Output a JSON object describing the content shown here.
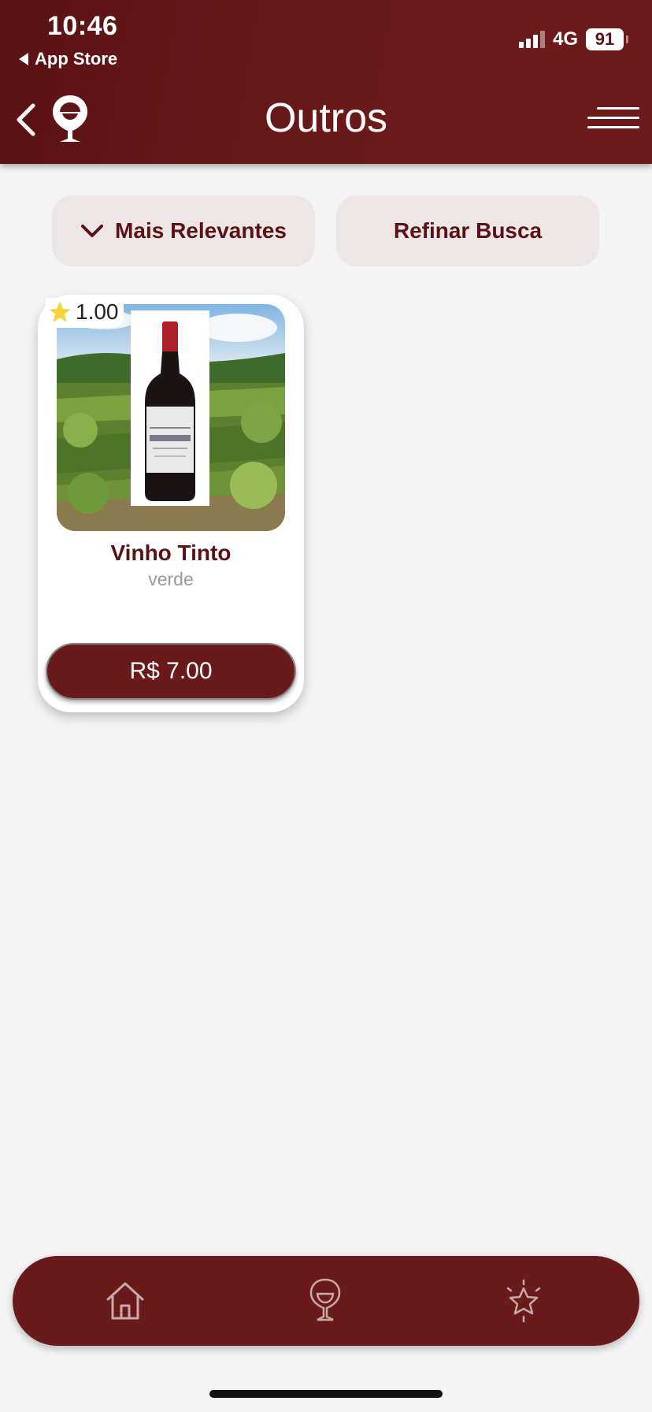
{
  "status_bar": {
    "time": "10:46",
    "back_app": "App Store",
    "network": "4G",
    "battery": "91"
  },
  "header": {
    "title": "Outros",
    "back_icon": "chevron-left-icon",
    "logo_icon": "wine-glass-pin-icon",
    "menu_icon": "hamburger-menu-icon"
  },
  "filters": {
    "sort_label": "Mais Relevantes",
    "refine_label": "Refinar Busca"
  },
  "products": [
    {
      "rating": "1.00",
      "name": "Vinho Tinto",
      "subtitle": "verde",
      "price": "R$ 7.00"
    }
  ],
  "bottom_nav": {
    "items": [
      "home-icon",
      "wine-glass-icon",
      "star-icon"
    ]
  },
  "colors": {
    "primary": "#6a1a1a",
    "filter_bg": "#ece6e6",
    "background": "#f4f4f4",
    "rating_star": "#f5d33b"
  }
}
